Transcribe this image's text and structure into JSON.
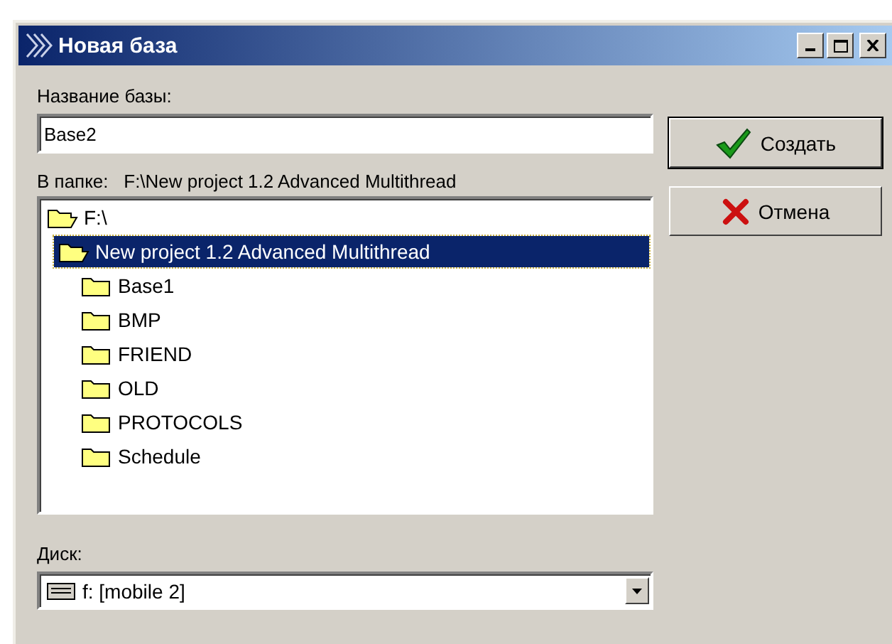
{
  "window": {
    "title": "Новая база"
  },
  "name_field": {
    "label": "Название базы:",
    "value": "Base2"
  },
  "folder": {
    "label": "В папке:",
    "path": "F:\\New project 1.2 Advanced Multithread"
  },
  "tree": [
    {
      "label": "F:\\",
      "expanded": true,
      "selected": false,
      "children": [
        {
          "label": "New project 1.2 Advanced Multithread",
          "expanded": true,
          "selected": true,
          "children": [
            {
              "label": "Base1",
              "expanded": false,
              "selected": false
            },
            {
              "label": "BMP",
              "expanded": false,
              "selected": false
            },
            {
              "label": "FRIEND",
              "expanded": false,
              "selected": false
            },
            {
              "label": "OLD",
              "expanded": false,
              "selected": false
            },
            {
              "label": "PROTOCOLS",
              "expanded": false,
              "selected": false
            },
            {
              "label": "Schedule",
              "expanded": false,
              "selected": false
            }
          ]
        }
      ]
    }
  ],
  "disk": {
    "label": "Диск:",
    "value": "f: [mobile 2]"
  },
  "buttons": [
    {
      "kind": "ok",
      "label": "Создать"
    },
    {
      "kind": "cancel",
      "label": "Отмена"
    }
  ]
}
